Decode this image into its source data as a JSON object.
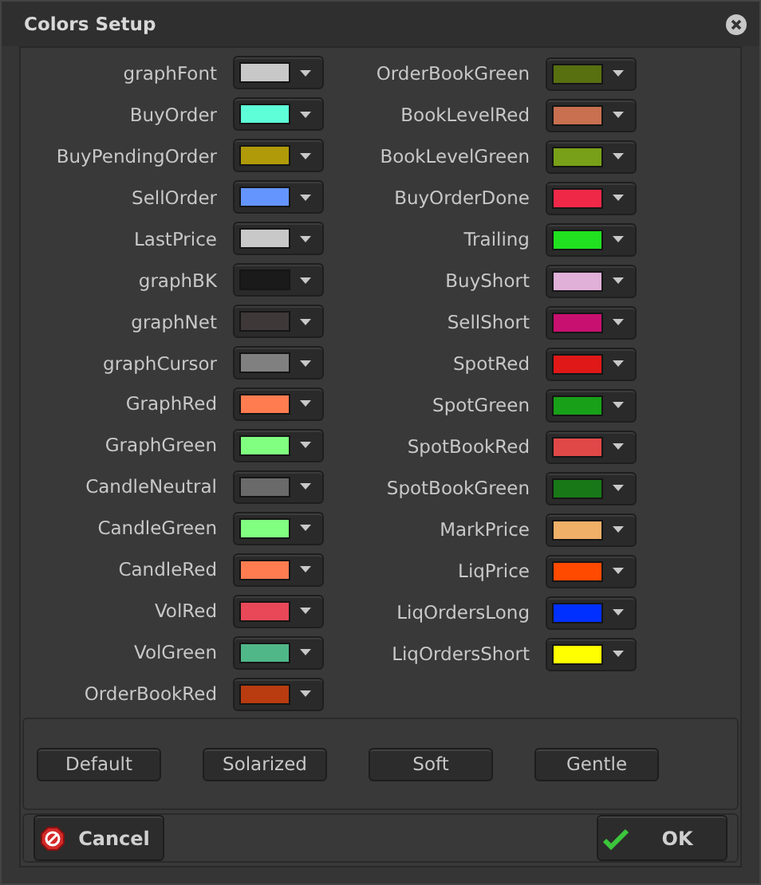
{
  "window": {
    "title": "Colors Setup"
  },
  "color_columns": [
    [
      {
        "name": "graphFont",
        "color": "#c8c8c8"
      },
      {
        "name": "BuyOrder",
        "color": "#5effd8"
      },
      {
        "name": "BuyPendingOrder",
        "color": "#b09a0a"
      },
      {
        "name": "SellOrder",
        "color": "#6495ff"
      },
      {
        "name": "LastPrice",
        "color": "#c8c8c8"
      },
      {
        "name": "graphBK",
        "color": "#1a1a1a"
      },
      {
        "name": "graphNet",
        "color": "#3f3838"
      },
      {
        "name": "graphCursor",
        "color": "#808080"
      },
      {
        "name": "GraphRed",
        "color": "#ff7c50"
      },
      {
        "name": "GraphGreen",
        "color": "#80ff80"
      },
      {
        "name": "CandleNeutral",
        "color": "#6a6a6a"
      },
      {
        "name": "CandleGreen",
        "color": "#80ff80"
      },
      {
        "name": "CandleRed",
        "color": "#ff7c50"
      },
      {
        "name": "VolRed",
        "color": "#e84858"
      },
      {
        "name": "VolGreen",
        "color": "#50b888"
      },
      {
        "name": "OrderBookRed",
        "color": "#b83c10"
      }
    ],
    [
      {
        "name": "OrderBookGreen",
        "color": "#587010"
      },
      {
        "name": "BookLevelRed",
        "color": "#c87050"
      },
      {
        "name": "BookLevelGreen",
        "color": "#78a018"
      },
      {
        "name": "BuyOrderDone",
        "color": "#f02848"
      },
      {
        "name": "Trailing",
        "color": "#20e020"
      },
      {
        "name": "BuyShort",
        "color": "#e0b0d8"
      },
      {
        "name": "SellShort",
        "color": "#c81070"
      },
      {
        "name": "SpotRed",
        "color": "#e01818"
      },
      {
        "name": "SpotGreen",
        "color": "#18a018"
      },
      {
        "name": "SpotBookRed",
        "color": "#e04848"
      },
      {
        "name": "SpotBookGreen",
        "color": "#187818"
      },
      {
        "name": "MarkPrice",
        "color": "#f0b068"
      },
      {
        "name": "LiqPrice",
        "color": "#ff4a00"
      },
      {
        "name": "LiqOrdersLong",
        "color": "#0030ff"
      },
      {
        "name": "LiqOrdersShort",
        "color": "#ffff00"
      }
    ]
  ],
  "presets": [
    "Default",
    "Solarized",
    "Soft",
    "Gentle"
  ],
  "buttons": [
    {
      "label": "Cancel",
      "kind": "cancel"
    },
    {
      "label": "OK",
      "kind": "ok"
    }
  ]
}
